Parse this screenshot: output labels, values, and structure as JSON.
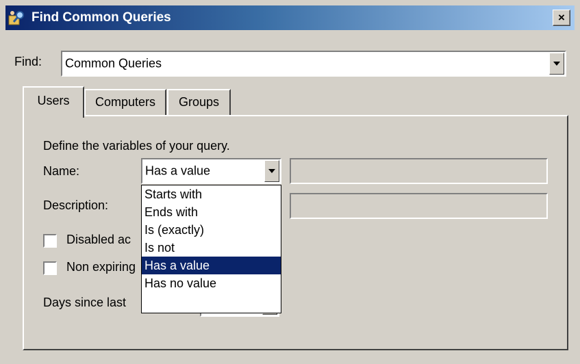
{
  "window": {
    "title": "Find Common Queries",
    "close_glyph": "×"
  },
  "find": {
    "label": "Find:",
    "value": "Common Queries"
  },
  "tabs": [
    {
      "label": "Users",
      "active": true
    },
    {
      "label": "Computers",
      "active": false
    },
    {
      "label": "Groups",
      "active": false
    }
  ],
  "panel": {
    "instruction": "Define the variables of your query.",
    "name_label": "Name:",
    "name_condition": "Has a value",
    "description_label": "Description:",
    "disabled_accounts_label": "Disabled ac",
    "non_expiring_label": "Non expiring",
    "days_since_label": "Days since last"
  },
  "name_dropdown": {
    "options": [
      "Starts with",
      "Ends with",
      "Is (exactly)",
      "Is not",
      "Has a value",
      "Has no value"
    ],
    "selected": "Has a value"
  },
  "colors": {
    "title_gradient_start": "#0a246a",
    "title_gradient_end": "#a6caf0",
    "selection": "#0a246a",
    "face": "#d4d0c8"
  },
  "icons": {
    "title": "find-people-icon",
    "close": "close-icon",
    "dropdown": "chevron-down-icon"
  }
}
